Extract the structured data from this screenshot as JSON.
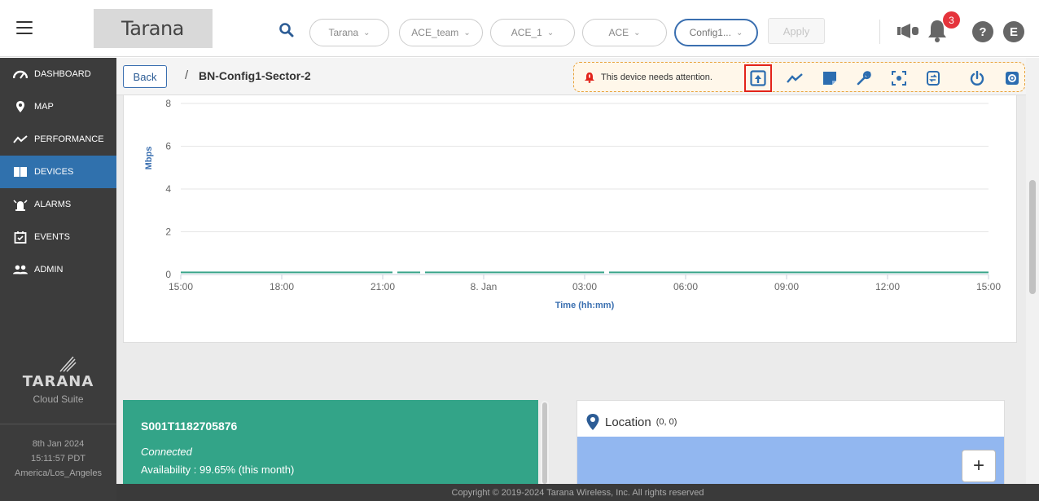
{
  "header": {
    "brand": "Tarana",
    "filters": [
      {
        "label": "Tarana"
      },
      {
        "label": "ACE_team"
      },
      {
        "label": "ACE_1"
      },
      {
        "label": "ACE"
      },
      {
        "label": "Config1..."
      }
    ],
    "apply_label": "Apply",
    "notification_count": "3",
    "help_label": "?",
    "user_initial": "E"
  },
  "sidebar": {
    "items": [
      {
        "label": "DASHBOARD",
        "icon": "dashboard-icon"
      },
      {
        "label": "MAP",
        "icon": "map-pin-icon"
      },
      {
        "label": "PERFORMANCE",
        "icon": "performance-icon"
      },
      {
        "label": "DEVICES",
        "icon": "devices-icon"
      },
      {
        "label": "ALARMS",
        "icon": "alarm-icon"
      },
      {
        "label": "EVENTS",
        "icon": "calendar-icon"
      },
      {
        "label": "ADMIN",
        "icon": "users-icon"
      }
    ],
    "active_item": "DEVICES",
    "logo_word": "TARANA",
    "logo_suite": "Cloud Suite",
    "date": "8th Jan 2024",
    "time": "15:11:57 PDT",
    "timezone": "America/Los_Angeles"
  },
  "breadcrumb": {
    "back_label": "Back",
    "separator": "/",
    "title": "BN-Config1-Sector-2"
  },
  "attention": {
    "text": "This device needs attention."
  },
  "chart_data": {
    "type": "line",
    "title": "",
    "xlabel": "Time (hh:mm)",
    "ylabel": "Mbps",
    "ylim": [
      0,
      8
    ],
    "yticks": [
      0,
      2,
      4,
      6,
      8
    ],
    "xticks": [
      "15:00",
      "18:00",
      "21:00",
      "8. Jan",
      "03:00",
      "06:00",
      "09:00",
      "12:00",
      "15:00"
    ],
    "series": [
      {
        "color": "#3aa58a",
        "values": [
          0.1,
          0.1,
          0.1,
          0.1,
          0.1,
          0.1,
          0.1,
          0.1,
          0.1
        ]
      }
    ],
    "grid": true
  },
  "device_card": {
    "serial": "S001T1182705876",
    "status": "Connected",
    "availability": "Availability : 99.65% (this month)",
    "color": "#33a488"
  },
  "location": {
    "title": "Location",
    "coords": "(0, 0)",
    "zoom_in": "+"
  },
  "footer": {
    "copyright": "Copyright © 2019-2024 Tarana Wireless, Inc. All rights reserved"
  },
  "colors": {
    "accent": "#3071ad",
    "sidebar_bg": "#3c3c3c",
    "attention_border": "#e8a33c",
    "alert_red": "#e5343c"
  }
}
